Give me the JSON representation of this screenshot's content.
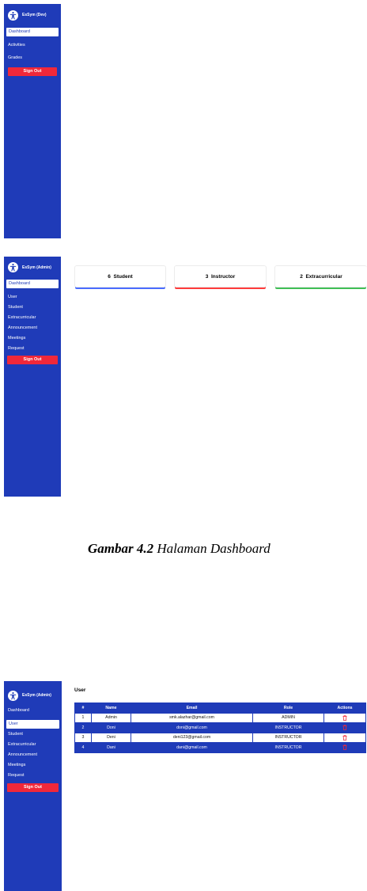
{
  "dev_screen": {
    "brand": "EsSym (Dev)",
    "nav": [
      "Dashboard",
      "Activities",
      "Grades"
    ],
    "sign_out": "Sign Out"
  },
  "admin_dashboard": {
    "brand": "EsSym (Admin)",
    "nav": [
      "Dashboard",
      "User",
      "Student",
      "Extracurricular",
      "Announcement",
      "Meetings",
      "Request"
    ],
    "sign_out": "Sign Out",
    "cards": [
      {
        "label": "6  Student",
        "color": "#4a6cff"
      },
      {
        "label": "3  Instructor",
        "color": "#ff3b3b"
      },
      {
        "label": "2  Extracurricular",
        "color": "#3fbf56"
      }
    ]
  },
  "caption": {
    "number": "Gambar 4.2",
    "text": " Halaman Dashboard"
  },
  "admin_user": {
    "brand": "EsSym (Admin)",
    "nav": [
      "Dashboard",
      "User",
      "Student",
      "Extracurricular",
      "Announcement",
      "Meetings",
      "Request"
    ],
    "sign_out": "Sign Out",
    "title": "User",
    "columns": [
      "#",
      "Name",
      "Email",
      "Role",
      "Actions"
    ],
    "rows": [
      {
        "no": "1",
        "name": "Admin",
        "email": "smk.alazhar@gmail.com",
        "role": "ADMIN"
      },
      {
        "no": "2",
        "name": "Doni",
        "email": "doni@gmail.com",
        "role": "INSTRUCTOR"
      },
      {
        "no": "3",
        "name": "Deni",
        "email": "deni123@gmail.com",
        "role": "INSTRUCTOR"
      },
      {
        "no": "4",
        "name": "Dani",
        "email": "dani@gmail.com",
        "role": "INSTRUCTOR"
      }
    ]
  },
  "colors": {
    "sidebar": "#1f3bb8",
    "danger": "#f0283a",
    "accent_blue": "#4a6cff",
    "accent_red": "#ff3b3b",
    "accent_green": "#3fbf56"
  }
}
